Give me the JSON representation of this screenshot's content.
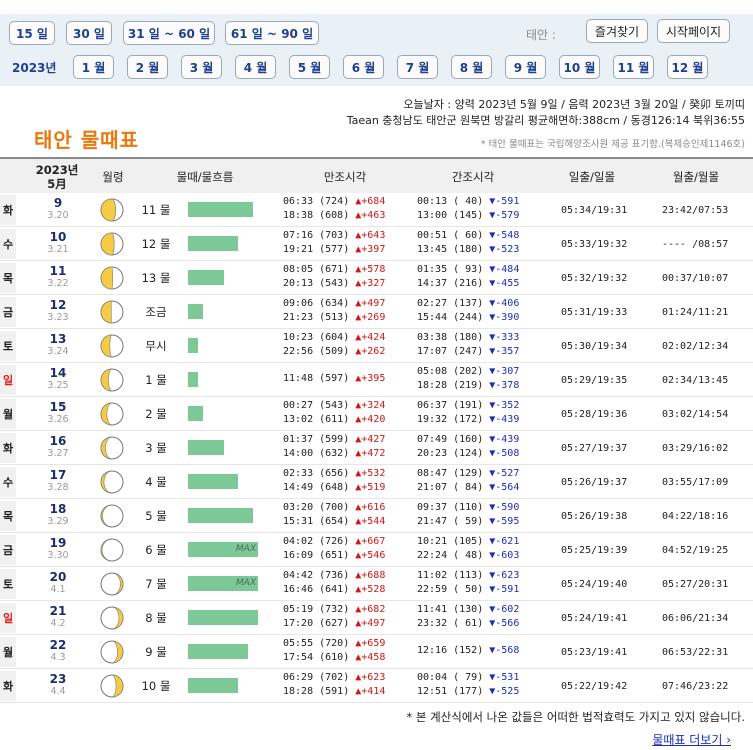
{
  "nav": {
    "range_buttons": [
      "15 일",
      "30 일",
      "31 일 ~ 60 일",
      "61 일 ~ 90 일"
    ],
    "location_label": "태안 :",
    "favorites_label": "즐겨찾기",
    "homepage_label": "시작페이지",
    "year_label": "2023년",
    "months": [
      "1 월",
      "2 월",
      "3 월",
      "4 월",
      "5 월",
      "6 월",
      "7 월",
      "8 월",
      "9 월",
      "10 월",
      "11 월",
      "12 월"
    ]
  },
  "header": {
    "today": "오늘날자 : 양력 2023년 5월 9일 / 음력 2023년 3월 20일 / 癸卯 토끼띠",
    "location": "Taean 충청남도 태안군 원북면 방갈리 평균해면하:388cm / 동경126:14 북위36:55",
    "title": "태안 물때표",
    "note": "* 태안 물때표는 국립해양조사원 제공 표기함.(복제승인제1146호)"
  },
  "table": {
    "head_year": "2023년",
    "head_month": "5月",
    "columns": [
      "월령",
      "물때/물흐름",
      "만조시각",
      "간조시각",
      "일출/일몰",
      "월출/월몰"
    ],
    "max_label": "MAX",
    "rows": [
      {
        "dow": "화",
        "sun": false,
        "day": "9",
        "lunar": "3.20",
        "phase": 0.65,
        "tide": "11 물",
        "flow": 0.93,
        "max": false,
        "hi1": "06:33 (724) ",
        "hi1d": "▲+684",
        "hi2": "18:38 (608) ",
        "hi2d": "▲+463",
        "lo1": "00:13 ( 40) ",
        "lo1d": "▼-591",
        "lo2": "13:00 (145) ",
        "lo2d": "▼-579",
        "sun_time": "05:34/19:31",
        "moon_time": "23:42/07:53"
      },
      {
        "dow": "수",
        "sun": false,
        "day": "10",
        "lunar": "3.21",
        "phase": 0.68,
        "tide": "12 물",
        "flow": 0.71,
        "max": false,
        "hi1": "07:16 (703) ",
        "hi1d": "▲+643",
        "hi2": "19:21 (577) ",
        "hi2d": "▲+397",
        "lo1": "00:51 ( 60) ",
        "lo1d": "▼-548",
        "lo2": "13:45 (180) ",
        "lo2d": "▼-523",
        "sun_time": "05:33/19:32",
        "moon_time": "---- /08:57"
      },
      {
        "dow": "목",
        "sun": false,
        "day": "11",
        "lunar": "3.22",
        "phase": 0.72,
        "tide": "13 물",
        "flow": 0.51,
        "max": false,
        "hi1": "08:05 (671) ",
        "hi1d": "▲+578",
        "hi2": "20:13 (543) ",
        "hi2d": "▲+327",
        "lo1": "01:35 ( 93) ",
        "lo1d": "▼-484",
        "lo2": "14:37 (216) ",
        "lo2d": "▼-455",
        "sun_time": "05:32/19:32",
        "moon_time": "00:37/10:07"
      },
      {
        "dow": "금",
        "sun": false,
        "day": "12",
        "lunar": "3.23",
        "phase": 0.75,
        "tide": "조금",
        "flow": 0.21,
        "max": false,
        "hi1": "09:06 (634) ",
        "hi1d": "▲+497",
        "hi2": "21:23 (513) ",
        "hi2d": "▲+269",
        "lo1": "02:27 (137) ",
        "lo1d": "▼-406",
        "lo2": "15:44 (244) ",
        "lo2d": "▼-390",
        "sun_time": "05:31/19:33",
        "moon_time": "01:24/11:21"
      },
      {
        "dow": "토",
        "sun": false,
        "day": "13",
        "lunar": "3.24",
        "phase": 0.79,
        "tide": "무시",
        "flow": 0.14,
        "max": false,
        "hi1": "10:23 (604) ",
        "hi1d": "▲+424",
        "hi2": "22:56 (509) ",
        "hi2d": "▲+262",
        "lo1": "03:38 (180) ",
        "lo1d": "▼-333",
        "lo2": "17:07 (247) ",
        "lo2d": "▼-357",
        "sun_time": "05:30/19:34",
        "moon_time": "02:02/12:34"
      },
      {
        "dow": "일",
        "sun": true,
        "day": "14",
        "lunar": "3.25",
        "phase": 0.82,
        "tide": "1 물",
        "flow": 0.14,
        "max": false,
        "hi1": "11:48 (597) ",
        "hi1d": "▲+395",
        "hi2": "",
        "hi2d": "",
        "lo1": "05:08 (202) ",
        "lo1d": "▼-307",
        "lo2": "18:28 (219) ",
        "lo2d": "▼-378",
        "sun_time": "05:29/19:35",
        "moon_time": "02:34/13:45"
      },
      {
        "dow": "월",
        "sun": false,
        "day": "15",
        "lunar": "3.26",
        "phase": 0.86,
        "tide": "2 물",
        "flow": 0.21,
        "max": false,
        "hi1": "00:27 (543) ",
        "hi1d": "▲+324",
        "hi2": "13:02 (611) ",
        "hi2d": "▲+420",
        "lo1": "06:37 (191) ",
        "lo1d": "▼-352",
        "lo2": "19:32 (172) ",
        "lo2d": "▼-439",
        "sun_time": "05:28/19:36",
        "moon_time": "03:02/14:54"
      },
      {
        "dow": "화",
        "sun": false,
        "day": "16",
        "lunar": "3.27",
        "phase": 0.89,
        "tide": "3 물",
        "flow": 0.51,
        "max": false,
        "hi1": "01:37 (599) ",
        "hi1d": "▲+427",
        "hi2": "14:00 (632) ",
        "hi2d": "▲+472",
        "lo1": "07:49 (160) ",
        "lo1d": "▼-439",
        "lo2": "20:23 (124) ",
        "lo2d": "▼-508",
        "sun_time": "05:27/19:37",
        "moon_time": "03:29/16:02"
      },
      {
        "dow": "수",
        "sun": false,
        "day": "17",
        "lunar": "3.28",
        "phase": 0.92,
        "tide": "4 물",
        "flow": 0.71,
        "max": false,
        "hi1": "02:33 (656) ",
        "hi1d": "▲+532",
        "hi2": "14:49 (648) ",
        "hi2d": "▲+519",
        "lo1": "08:47 (129) ",
        "lo1d": "▼-527",
        "lo2": "21:07 ( 84) ",
        "lo2d": "▼-564",
        "sun_time": "05:26/19:37",
        "moon_time": "03:55/17:09"
      },
      {
        "dow": "목",
        "sun": false,
        "day": "18",
        "lunar": "3.29",
        "phase": 0.96,
        "tide": "5 물",
        "flow": 0.93,
        "max": false,
        "hi1": "03:20 (700) ",
        "hi1d": "▲+616",
        "hi2": "15:31 (654) ",
        "hi2d": "▲+544",
        "lo1": "09:37 (110) ",
        "lo1d": "▼-590",
        "lo2": "21:47 ( 59) ",
        "lo2d": "▼-595",
        "sun_time": "05:26/19:38",
        "moon_time": "04:22/18:16"
      },
      {
        "dow": "금",
        "sun": false,
        "day": "19",
        "lunar": "3.30",
        "phase": 1.0,
        "tide": "6 물",
        "flow": 1.0,
        "max": true,
        "hi1": "04:02 (726) ",
        "hi1d": "▲+667",
        "hi2": "16:09 (651) ",
        "hi2d": "▲+546",
        "lo1": "10:21 (105) ",
        "lo1d": "▼-621",
        "lo2": "22:24 ( 48) ",
        "lo2d": "▼-603",
        "sun_time": "05:25/19:39",
        "moon_time": "04:52/19:25"
      },
      {
        "dow": "토",
        "sun": false,
        "day": "20",
        "lunar": "4.1",
        "phase": 0.03,
        "tide": "7 물",
        "flow": 1.0,
        "max": true,
        "hi1": "04:42 (736) ",
        "hi1d": "▲+688",
        "hi2": "16:46 (641) ",
        "hi2d": "▲+528",
        "lo1": "11:02 (113) ",
        "lo1d": "▼-623",
        "lo2": "22:59 ( 50) ",
        "lo2d": "▼-591",
        "sun_time": "05:24/19:40",
        "moon_time": "05:27/20:31"
      },
      {
        "dow": "일",
        "sun": true,
        "day": "21",
        "lunar": "4.2",
        "phase": 0.06,
        "tide": "8 물",
        "flow": 1.0,
        "max": false,
        "hi1": "05:19 (732) ",
        "hi1d": "▲+682",
        "hi2": "17:20 (627) ",
        "hi2d": "▲+497",
        "lo1": "11:41 (130) ",
        "lo1d": "▼-602",
        "lo2": "23:32 ( 61) ",
        "lo2d": "▼-566",
        "sun_time": "05:24/19:41",
        "moon_time": "06:06/21:34"
      },
      {
        "dow": "월",
        "sun": false,
        "day": "22",
        "lunar": "4.3",
        "phase": 0.1,
        "tide": "9 물",
        "flow": 0.86,
        "max": false,
        "hi1": "05:55 (720) ",
        "hi1d": "▲+659",
        "hi2": "17:54 (610) ",
        "hi2d": "▲+458",
        "lo1": "12:16 (152) ",
        "lo1d": "▼-568",
        "lo2": "",
        "lo2d": "",
        "sun_time": "05:23/19:41",
        "moon_time": "06:53/22:31"
      },
      {
        "dow": "화",
        "sun": false,
        "day": "23",
        "lunar": "4.4",
        "phase": 0.14,
        "tide": "10 물",
        "flow": 0.71,
        "max": false,
        "hi1": "06:29 (702) ",
        "hi1d": "▲+623",
        "hi2": "18:28 (591) ",
        "hi2d": "▲+414",
        "lo1": "00:04 ( 79) ",
        "lo1d": "▼-531",
        "lo2": "12:51 (177) ",
        "lo2d": "▼-525",
        "sun_time": "05:22/19:42",
        "moon_time": "07:46/23:22"
      }
    ]
  },
  "footer": {
    "disclaimer": "* 본 계산식에서 나온 값들은 어떠한 법적효력도 가지고 있지 않습니다.",
    "more_link": "물때표 더보기 ›"
  },
  "colors": {
    "accent": "#e8790e",
    "high_tide": "#d01818",
    "low_tide": "#1a2fb8",
    "flow_bar": "#7cc897",
    "moon": "#f5cb45"
  }
}
